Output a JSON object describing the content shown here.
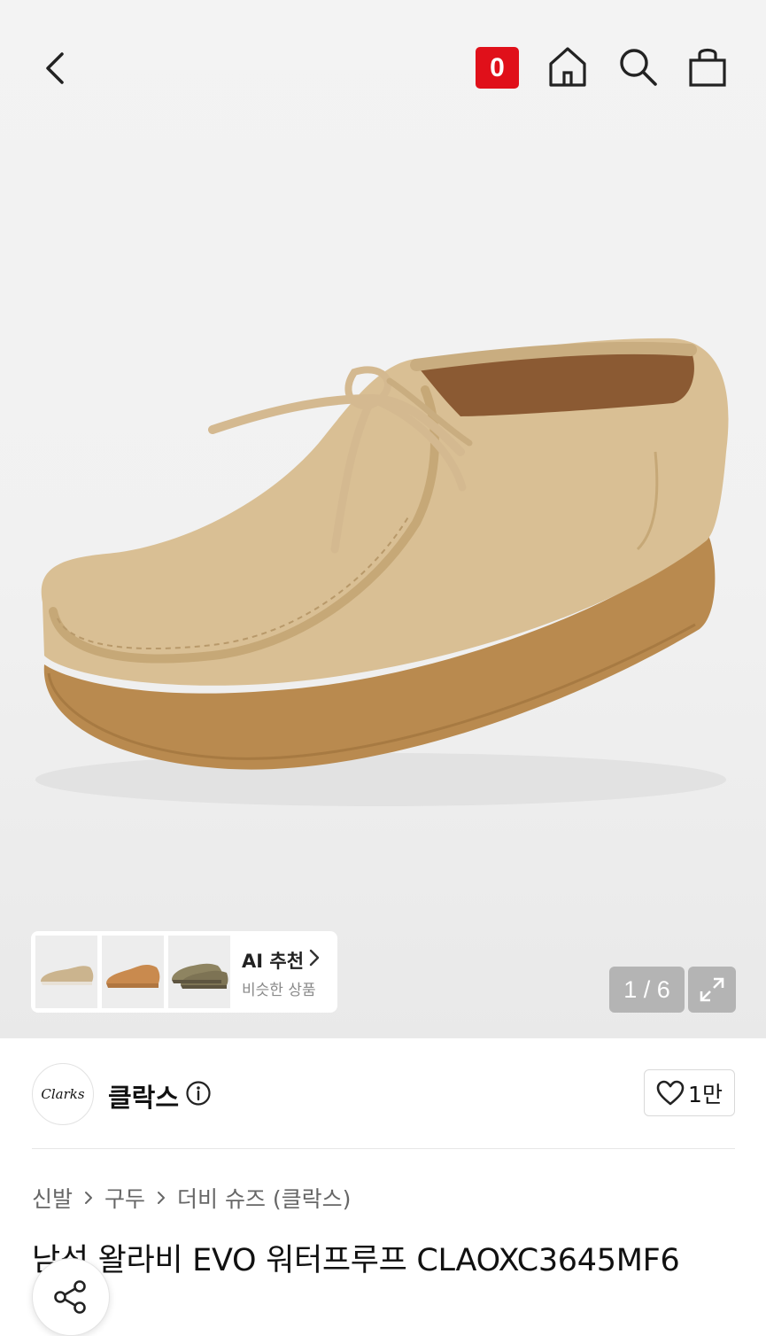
{
  "header": {
    "back_icon": "chevron-left-icon",
    "cart_badge": "0",
    "home_icon": "home-icon",
    "search_icon": "search-icon",
    "bag_icon": "shopping-bag-icon"
  },
  "gallery": {
    "current": "1",
    "total": "6",
    "counter": "1 / 6",
    "expand_icon": "expand-icon"
  },
  "ai_recommend": {
    "title": "AI 추천",
    "subtitle": "비슷한 상품",
    "thumbnails": 3
  },
  "brand": {
    "logo_text": "Clarks",
    "name": "클락스",
    "info_icon": "info-icon",
    "like_count": "1만"
  },
  "breadcrumb": [
    "신발",
    "구두",
    "더비 슈즈 (클락스)"
  ],
  "product": {
    "title": "남성 왈라비 EVO 워터프루프 CLAOXC3645MF6"
  },
  "colors": {
    "badge": "#e0101a",
    "suede": "#d9bf94",
    "sole": "#b98a4f"
  }
}
